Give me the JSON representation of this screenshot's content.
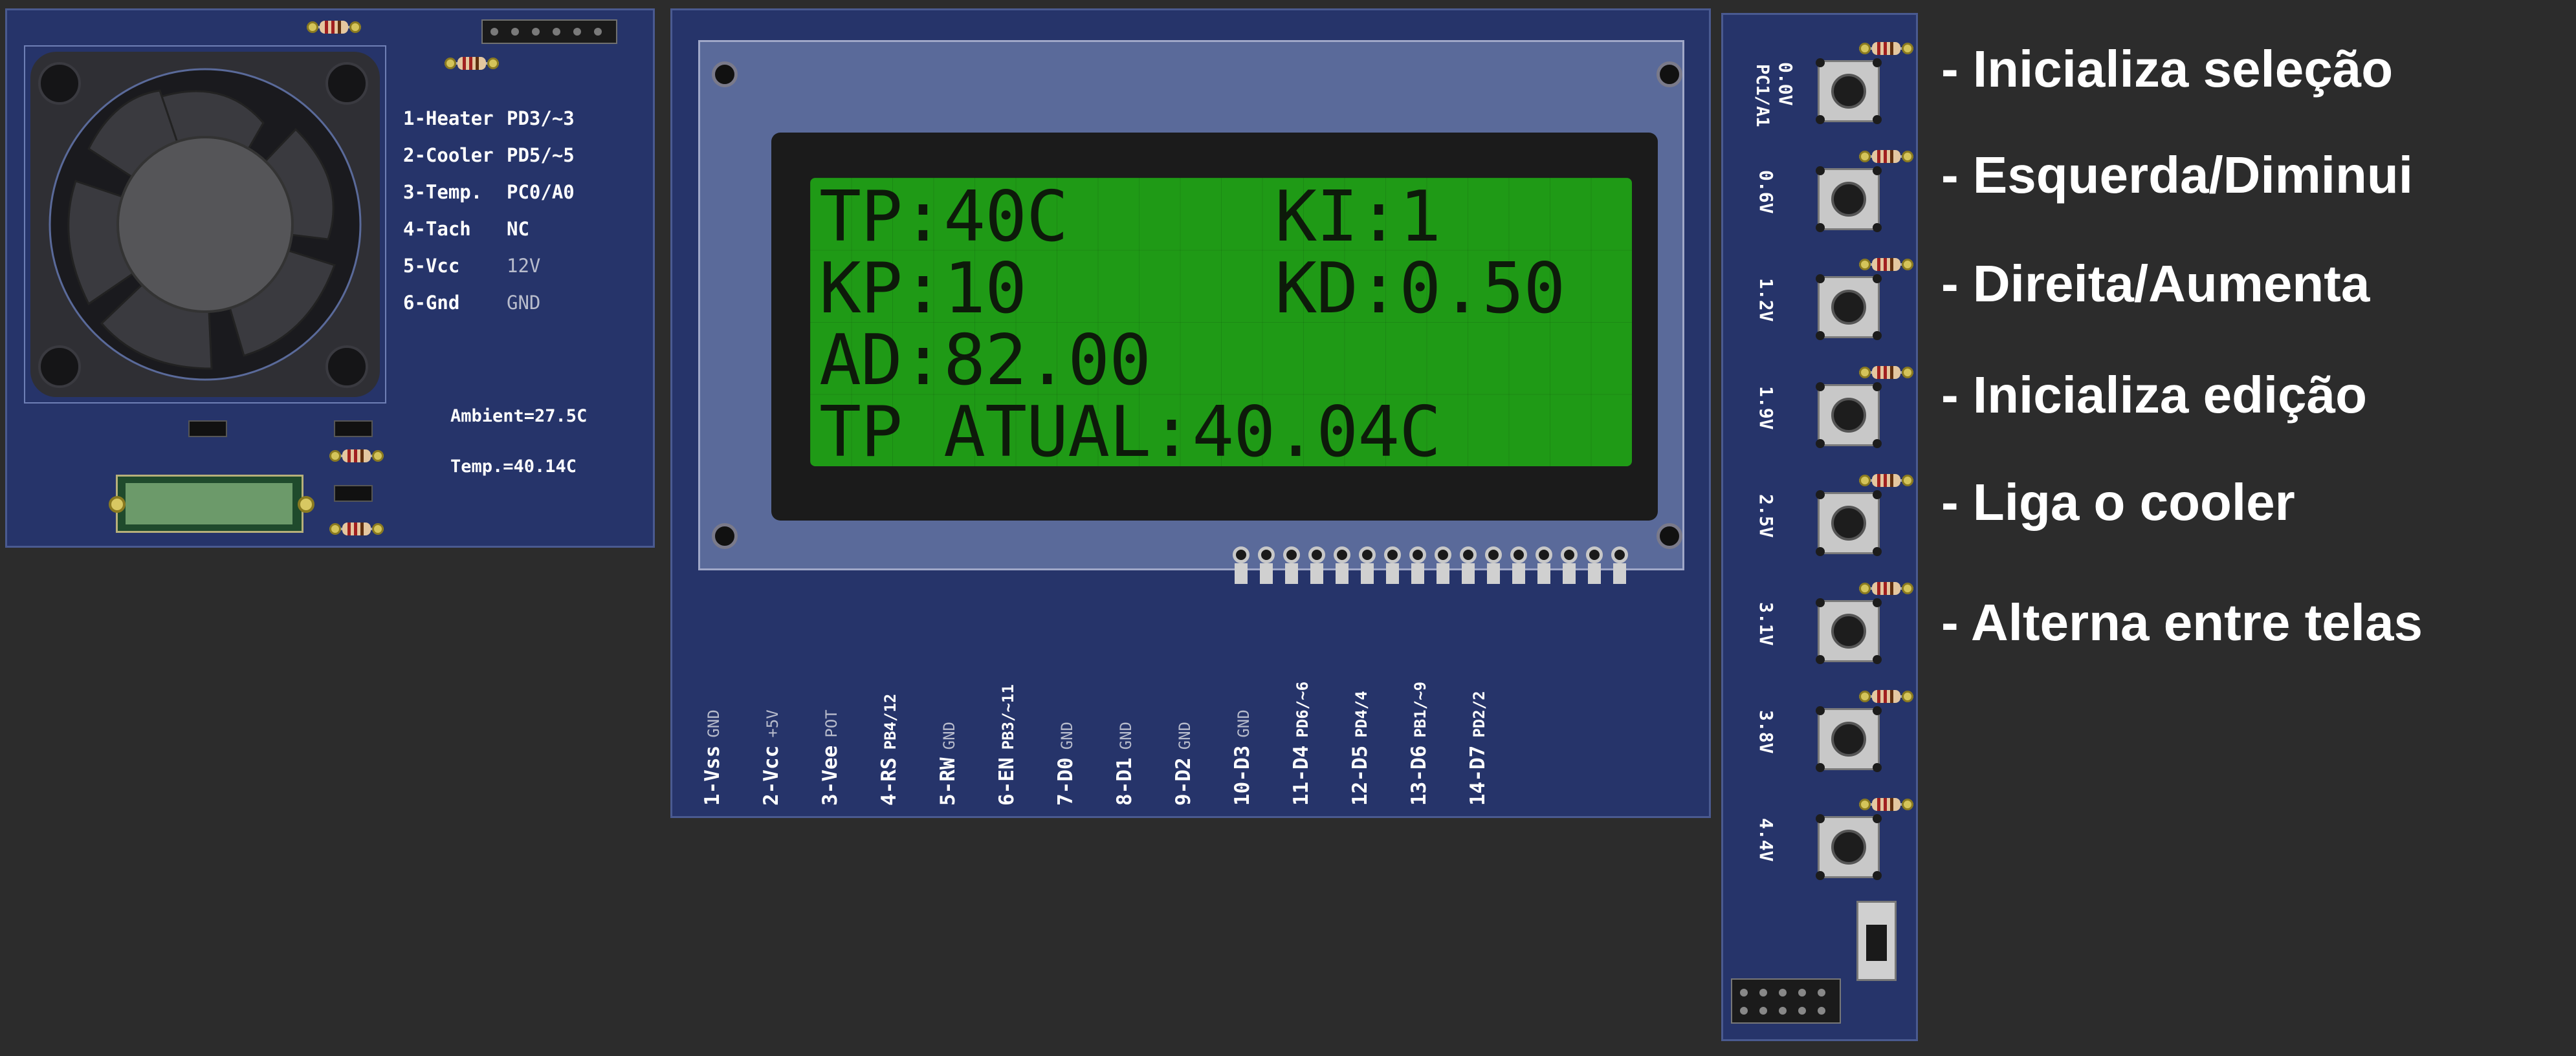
{
  "fan_board": {
    "legend": [
      {
        "label": "1-Heater",
        "signal": "PD3/~3"
      },
      {
        "label": "2-Cooler",
        "signal": "PD5/~5"
      },
      {
        "label": "3-Temp.",
        "signal": "PC0/A0"
      },
      {
        "label": "4-Tach",
        "signal": "NC"
      },
      {
        "label": "5-Vcc",
        "signal": "12V"
      },
      {
        "label": "6-Gnd",
        "signal": "GND"
      }
    ],
    "ambient": "Ambient=27.5C",
    "temp": "Temp.=40.14C"
  },
  "lcd": {
    "rows": [
      "TP:40C     KI:1",
      "KP:10      KD:0.50",
      "AD:82.00",
      "TP ATUAL:40.04C"
    ],
    "background_color": "#1f9a16",
    "pins": [
      {
        "label": "1-Vss",
        "signal": "GND"
      },
      {
        "label": "2-Vcc",
        "signal": "+5V"
      },
      {
        "label": "3-Vee",
        "signal": "POT"
      },
      {
        "label": "4-RS",
        "signal": "PB4/12"
      },
      {
        "label": "5-RW",
        "signal": "GND"
      },
      {
        "label": "6-EN",
        "signal": "PB3/~11"
      },
      {
        "label": "7-D0",
        "signal": "GND"
      },
      {
        "label": "8-D1",
        "signal": "GND"
      },
      {
        "label": "9-D2",
        "signal": "GND"
      },
      {
        "label": "10-D3",
        "signal": "GND"
      },
      {
        "label": "11-D4",
        "signal": "PD6/~6"
      },
      {
        "label": "12-D5",
        "signal": "PD4/4"
      },
      {
        "label": "13-D6",
        "signal": "PB1/~9"
      },
      {
        "label": "14-D7",
        "signal": "PD2/2"
      }
    ]
  },
  "button_board": {
    "header_label": "PC1/A1",
    "voltages": [
      "0.0V",
      "0.6V",
      "1.2V",
      "1.9V",
      "2.5V",
      "3.1V",
      "3.8V",
      "4.4V"
    ]
  },
  "descriptions": [
    "- Inicializa seleção",
    "- Esquerda/Diminui",
    "- Direita/Aumenta",
    "- Inicializa edição",
    "- Liga o cooler",
    "- Alterna entre telas"
  ],
  "colors": {
    "background": "#2c2c2c",
    "board": "#26346a",
    "lcd_green": "#1f9a16",
    "text": "#ffffff"
  }
}
